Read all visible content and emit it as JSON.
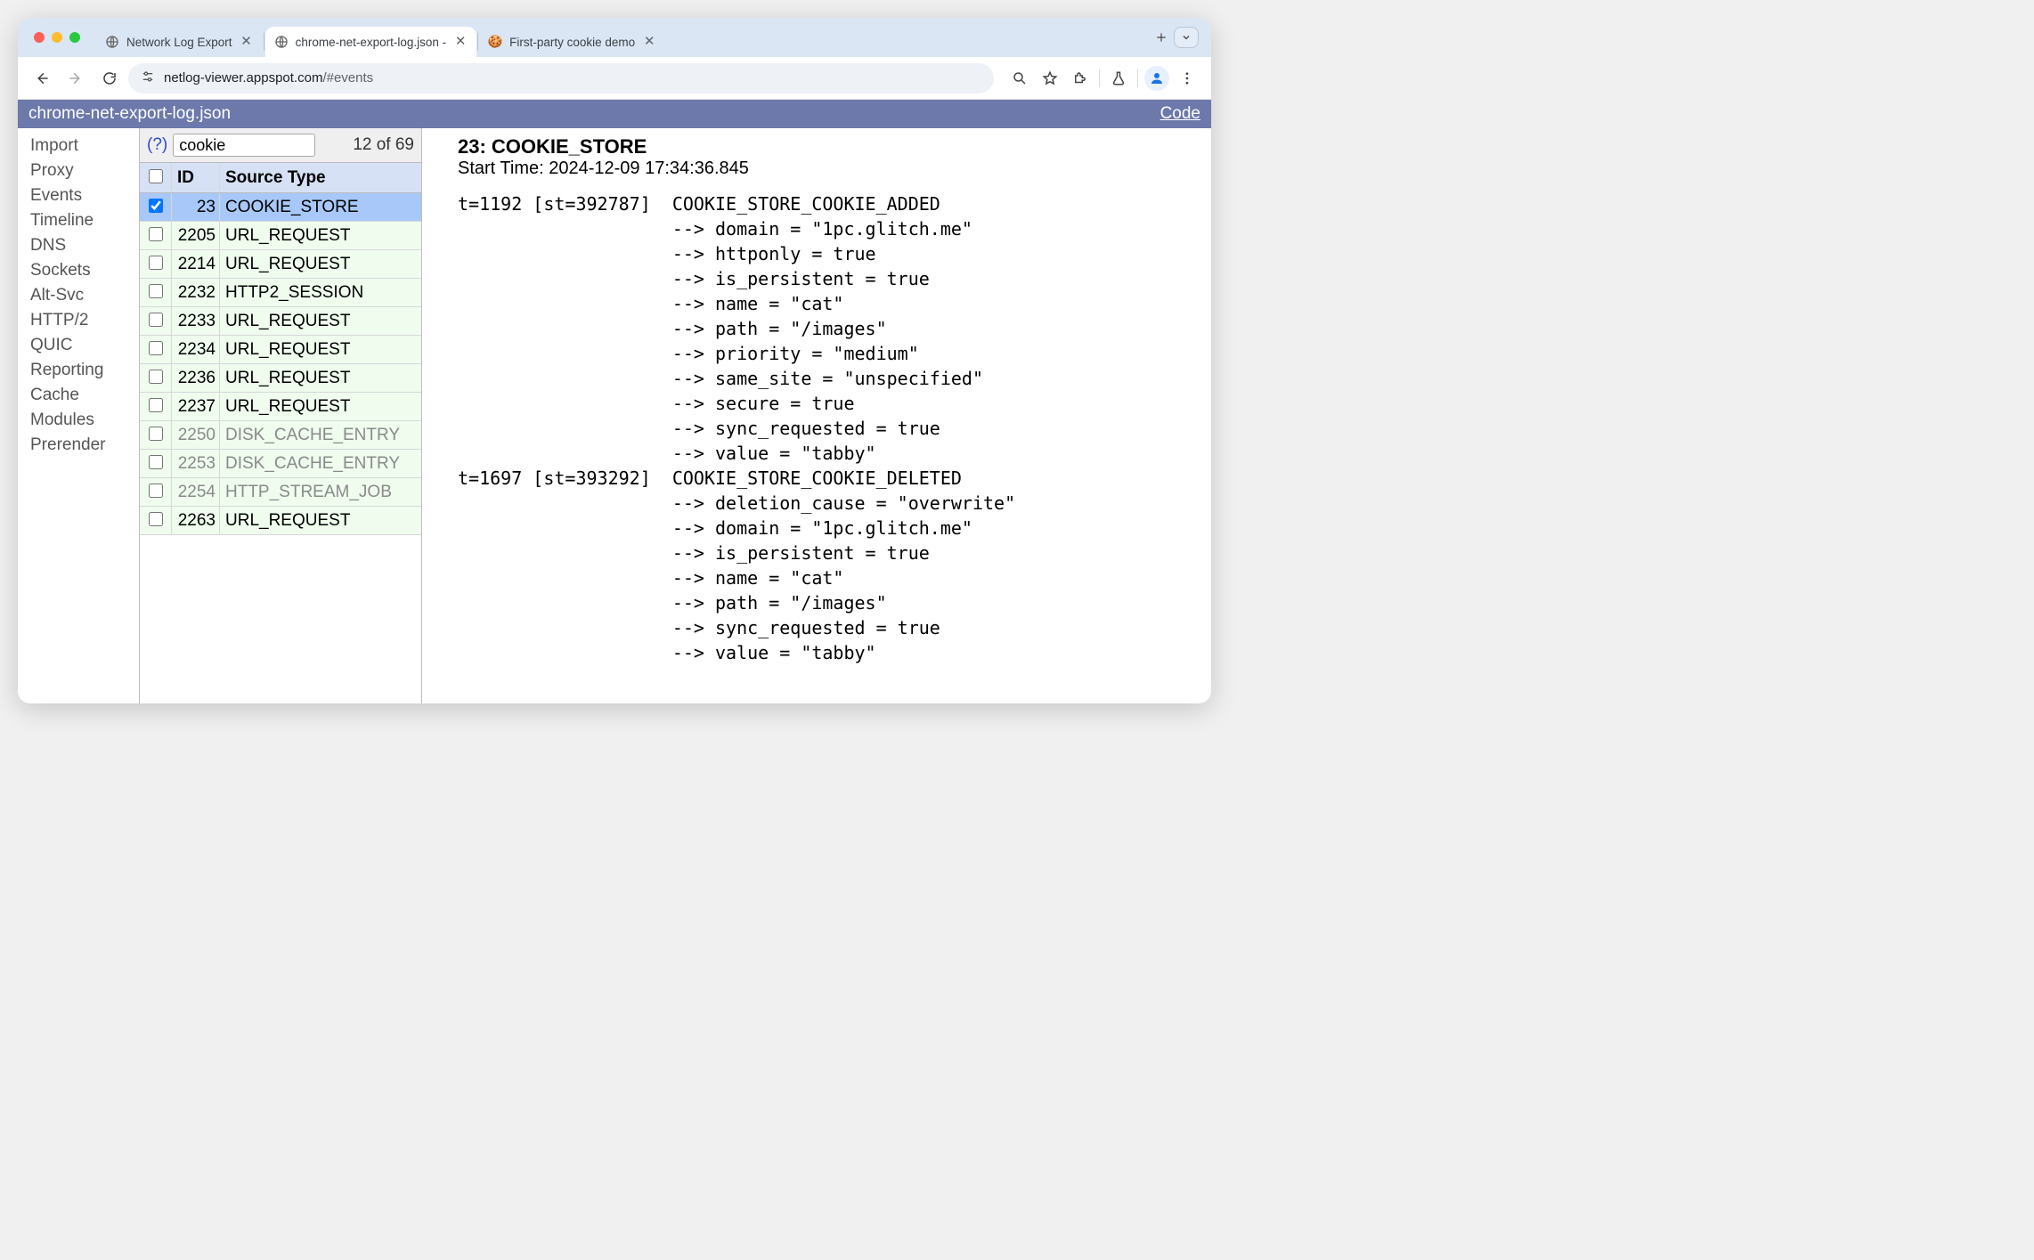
{
  "browser": {
    "tabs": [
      {
        "title": "Network Log Export",
        "favicon": "globe",
        "active": false
      },
      {
        "title": "chrome-net-export-log.json - ",
        "favicon": "globe",
        "active": true
      },
      {
        "title": "First-party cookie demo",
        "favicon": "cookie",
        "active": false
      }
    ],
    "url_host": "netlog-viewer.appspot.com",
    "url_path": "/#events"
  },
  "pagebar": {
    "filename": "chrome-net-export-log.json",
    "code_link": "Code"
  },
  "sidebar": {
    "items": [
      "Import",
      "Proxy",
      "Events",
      "Timeline",
      "DNS",
      "Sockets",
      "Alt-Svc",
      "HTTP/2",
      "QUIC",
      "Reporting",
      "Cache",
      "Modules",
      "Prerender"
    ]
  },
  "filter": {
    "help": "(?)",
    "value": "cookie",
    "count_text": "12 of 69"
  },
  "events": {
    "headers": {
      "id": "ID",
      "source_type": "Source Type"
    },
    "rows": [
      {
        "id": "23",
        "source_type": "COOKIE_STORE",
        "selected": true,
        "inactive": false
      },
      {
        "id": "2205",
        "source_type": "URL_REQUEST",
        "selected": false,
        "inactive": false
      },
      {
        "id": "2214",
        "source_type": "URL_REQUEST",
        "selected": false,
        "inactive": false
      },
      {
        "id": "2232",
        "source_type": "HTTP2_SESSION",
        "selected": false,
        "inactive": false
      },
      {
        "id": "2233",
        "source_type": "URL_REQUEST",
        "selected": false,
        "inactive": false
      },
      {
        "id": "2234",
        "source_type": "URL_REQUEST",
        "selected": false,
        "inactive": false
      },
      {
        "id": "2236",
        "source_type": "URL_REQUEST",
        "selected": false,
        "inactive": false
      },
      {
        "id": "2237",
        "source_type": "URL_REQUEST",
        "selected": false,
        "inactive": false
      },
      {
        "id": "2250",
        "source_type": "DISK_CACHE_ENTRY",
        "selected": false,
        "inactive": true
      },
      {
        "id": "2253",
        "source_type": "DISK_CACHE_ENTRY",
        "selected": false,
        "inactive": true
      },
      {
        "id": "2254",
        "source_type": "HTTP_STREAM_JOB",
        "selected": false,
        "inactive": true
      },
      {
        "id": "2263",
        "source_type": "URL_REQUEST",
        "selected": false,
        "inactive": false
      }
    ]
  },
  "detail": {
    "title": "23: COOKIE_STORE",
    "start_time": "Start Time: 2024-12-09 17:34:36.845",
    "log": "t=1192 [st=392787]  COOKIE_STORE_COOKIE_ADDED\n                    --> domain = \"1pc.glitch.me\"\n                    --> httponly = true\n                    --> is_persistent = true\n                    --> name = \"cat\"\n                    --> path = \"/images\"\n                    --> priority = \"medium\"\n                    --> same_site = \"unspecified\"\n                    --> secure = true\n                    --> sync_requested = true\n                    --> value = \"tabby\"\nt=1697 [st=393292]  COOKIE_STORE_COOKIE_DELETED\n                    --> deletion_cause = \"overwrite\"\n                    --> domain = \"1pc.glitch.me\"\n                    --> is_persistent = true\n                    --> name = \"cat\"\n                    --> path = \"/images\"\n                    --> sync_requested = true\n                    --> value = \"tabby\""
  }
}
